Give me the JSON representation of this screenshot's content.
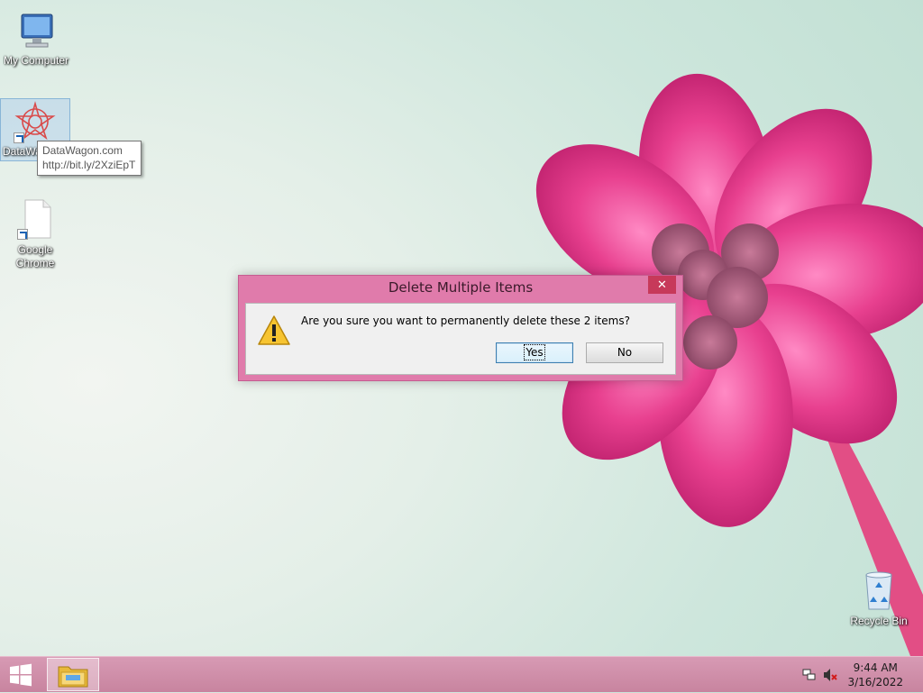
{
  "desktop": {
    "icons": [
      {
        "label": "My Computer",
        "icon": "computer-icon"
      },
      {
        "label": "DataWagon.com",
        "icon": "datawagon-icon"
      },
      {
        "label": "Google Chrome",
        "icon": "file-shortcut-icon"
      },
      {
        "label": "Recycle Bin",
        "icon": "recycle-bin-icon"
      }
    ],
    "tooltip": {
      "line1": "DataWagon.com",
      "line2": "http://bit.ly/2XziEpT"
    }
  },
  "dialog": {
    "title": "Delete Multiple Items",
    "close_label": "✕",
    "message": "Are you sure you want to permanently delete these 2 items?",
    "yes_label": "Yes",
    "no_label": "No",
    "icon": "warning-icon"
  },
  "taskbar": {
    "start_icon": "windows-logo-icon",
    "pinned": [
      {
        "name": "File Explorer",
        "icon": "folder-icon"
      }
    ],
    "tray": {
      "icons": [
        "network-icon",
        "volume-muted-icon"
      ],
      "time": "9:44 AM",
      "date": "3/16/2022"
    }
  },
  "colors": {
    "dialog_frame": "#e07bab",
    "close_button": "#c7395a",
    "taskbar": "#cf8eaa"
  }
}
